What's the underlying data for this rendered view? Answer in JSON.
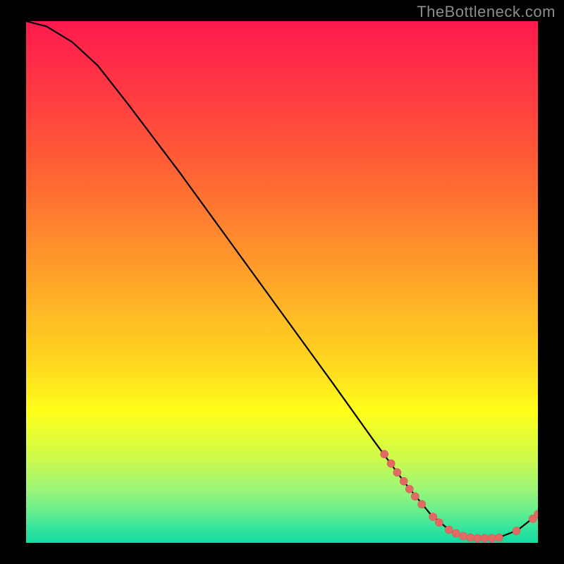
{
  "attribution": "TheBottleneck.com",
  "chart_data": {
    "type": "line",
    "title": "",
    "xlabel": "",
    "ylabel": "",
    "xlim": [
      0,
      100
    ],
    "ylim": [
      0,
      100
    ],
    "curve": [
      {
        "x": 0.0,
        "y": 100.0
      },
      {
        "x": 4.0,
        "y": 99.0
      },
      {
        "x": 9.0,
        "y": 96.0
      },
      {
        "x": 14.0,
        "y": 91.5
      },
      {
        "x": 20.0,
        "y": 84.0
      },
      {
        "x": 30.0,
        "y": 71.0
      },
      {
        "x": 40.0,
        "y": 57.5
      },
      {
        "x": 50.0,
        "y": 44.0
      },
      {
        "x": 60.0,
        "y": 30.5
      },
      {
        "x": 68.0,
        "y": 19.5
      },
      {
        "x": 74.0,
        "y": 11.5
      },
      {
        "x": 79.0,
        "y": 5.5
      },
      {
        "x": 83.0,
        "y": 2.2
      },
      {
        "x": 87.0,
        "y": 0.9
      },
      {
        "x": 92.0,
        "y": 0.9
      },
      {
        "x": 96.0,
        "y": 2.4
      },
      {
        "x": 100.0,
        "y": 5.5
      }
    ],
    "markers": [
      {
        "x": 70.0,
        "y": 17.0
      },
      {
        "x": 71.3,
        "y": 15.2
      },
      {
        "x": 72.5,
        "y": 13.5
      },
      {
        "x": 73.8,
        "y": 11.8
      },
      {
        "x": 74.9,
        "y": 10.3
      },
      {
        "x": 76.0,
        "y": 8.9
      },
      {
        "x": 77.3,
        "y": 7.4
      },
      {
        "x": 79.5,
        "y": 5.0
      },
      {
        "x": 80.7,
        "y": 3.9
      },
      {
        "x": 82.6,
        "y": 2.5
      },
      {
        "x": 84.0,
        "y": 1.8
      },
      {
        "x": 85.4,
        "y": 1.3
      },
      {
        "x": 86.8,
        "y": 1.0
      },
      {
        "x": 88.2,
        "y": 0.9
      },
      {
        "x": 89.6,
        "y": 0.9
      },
      {
        "x": 91.0,
        "y": 0.9
      },
      {
        "x": 92.4,
        "y": 1.0
      },
      {
        "x": 95.8,
        "y": 2.3
      },
      {
        "x": 99.0,
        "y": 4.6
      },
      {
        "x": 100.0,
        "y": 5.5
      }
    ],
    "gradient_stops": [
      {
        "pos": 0.0,
        "color": "#ff1a4d"
      },
      {
        "pos": 0.3,
        "color": "#ff6633"
      },
      {
        "pos": 0.66,
        "color": "#ffd91f"
      },
      {
        "pos": 0.9,
        "color": "#99f57a"
      },
      {
        "pos": 1.0,
        "color": "#10dca2"
      }
    ]
  }
}
